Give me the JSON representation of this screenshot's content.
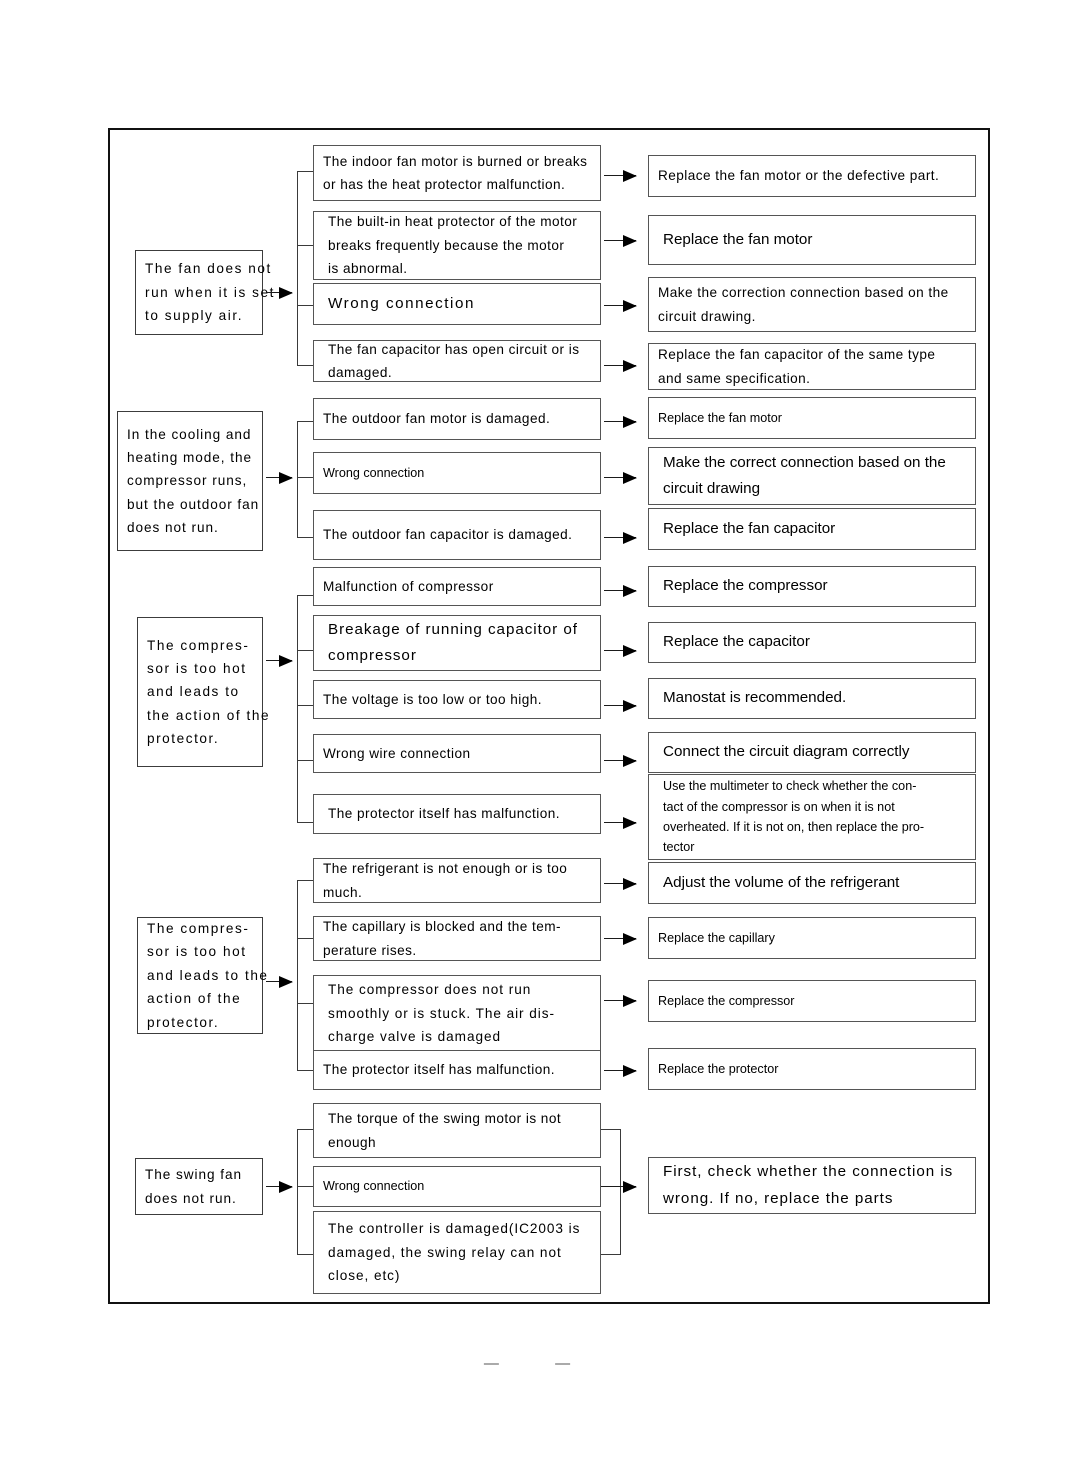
{
  "document": {
    "type": "troubleshooting-flowchart",
    "title": "Air conditioner fault diagnosis chart",
    "footer_marks": "— —"
  },
  "flow": {
    "sections": [
      {
        "id": "fan-supply-air",
        "symptom": {
          "lines": [
            "The fan does not",
            "run when it is set",
            "to supply air."
          ]
        },
        "branches": [
          {
            "cause": {
              "lines": [
                "The indoor fan motor is burned or breaks",
                "or has the heat protector malfunction."
              ]
            },
            "action": {
              "lines": [
                "Replace the fan motor or the defective part."
              ]
            }
          },
          {
            "cause": {
              "lines": [
                "The built-in heat protector of the motor",
                "breaks frequently because the motor",
                "is abnormal."
              ]
            },
            "action": {
              "lines": [
                "Replace the fan motor"
              ]
            }
          },
          {
            "cause": {
              "lines": [
                "Wrong connection"
              ]
            },
            "action": {
              "lines": [
                "Make the correction connection based on the",
                "circuit drawing."
              ]
            }
          },
          {
            "cause": {
              "lines": [
                "The fan capacitor has open circuit or is",
                "damaged."
              ]
            },
            "action": {
              "lines": [
                "Replace the fan capacitor of the same type",
                "and same specification."
              ]
            }
          }
        ]
      },
      {
        "id": "outdoor-fan",
        "symptom": {
          "lines": [
            "In the cooling and",
            "heating mode, the",
            "compressor runs,",
            "but the outdoor fan",
            "does not run."
          ]
        },
        "branches": [
          {
            "cause": {
              "lines": [
                "The outdoor fan motor is damaged."
              ]
            },
            "action": {
              "lines": [
                "Replace the fan motor"
              ]
            }
          },
          {
            "cause": {
              "lines": [
                "Wrong connection"
              ]
            },
            "action": {
              "lines": [
                "Make the correct connection based on the",
                "circuit drawing"
              ]
            }
          },
          {
            "cause": {
              "lines": [
                "The outdoor fan capacitor is damaged."
              ]
            },
            "action": {
              "lines": [
                "Replace the fan capacitor"
              ]
            }
          }
        ]
      },
      {
        "id": "compressor-hot-1",
        "symptom": {
          "lines": [
            "The compres-",
            "sor is too hot",
            "and leads to",
            "the action of the",
            "protector."
          ]
        },
        "branches": [
          {
            "cause": {
              "lines": [
                "Malfunction of compressor"
              ]
            },
            "action": {
              "lines": [
                "Replace the compressor"
              ]
            }
          },
          {
            "cause": {
              "lines": [
                "Breakage of running capacitor of",
                "compressor"
              ]
            },
            "action": {
              "lines": [
                "Replace the capacitor"
              ]
            }
          },
          {
            "cause": {
              "lines": [
                "The voltage is too low or too high."
              ]
            },
            "action": {
              "lines": [
                "Manostat is recommended."
              ]
            }
          },
          {
            "cause": {
              "lines": [
                "Wrong wire connection"
              ]
            },
            "action": {
              "lines": [
                "Connect the circuit diagram correctly"
              ]
            }
          },
          {
            "cause": {
              "lines": [
                "The protector itself has malfunction."
              ]
            },
            "action": {
              "lines": [
                "Use the multimeter to check whether the con-",
                "tact of the compressor is on when it is not",
                "overheated. If it is not on, then replace the pro-",
                "tector"
              ]
            }
          }
        ]
      },
      {
        "id": "compressor-hot-2",
        "symptom": {
          "lines": [
            "The compres-",
            "sor is too hot",
            "and leads to the",
            "action of the",
            "protector."
          ]
        },
        "branches": [
          {
            "cause": {
              "lines": [
                "The refrigerant is not enough or is too",
                "much."
              ]
            },
            "action": {
              "lines": [
                "Adjust the volume of the refrigerant"
              ]
            }
          },
          {
            "cause": {
              "lines": [
                "The capillary is blocked and the tem-",
                "perature rises."
              ]
            },
            "action": {
              "lines": [
                "Replace the capillary"
              ]
            }
          },
          {
            "cause": {
              "lines": [
                "The compressor does not run",
                "smoothly or is stuck. The air dis-",
                "charge valve is damaged"
              ]
            },
            "action": {
              "lines": [
                "Replace the compressor"
              ]
            }
          },
          {
            "cause": {
              "lines": [
                "The protector itself has malfunction."
              ]
            },
            "action": {
              "lines": [
                "Replace the protector"
              ]
            }
          }
        ]
      },
      {
        "id": "swing-fan",
        "symptom": {
          "lines": [
            "The swing fan",
            "does not run."
          ]
        },
        "shared_action": {
          "lines": [
            "First, check whether the connection is",
            "wrong. If no, replace the parts"
          ]
        },
        "branches": [
          {
            "cause": {
              "lines": [
                "The torque of the swing motor is not",
                "enough"
              ]
            }
          },
          {
            "cause": {
              "lines": [
                "Wrong connection"
              ]
            }
          },
          {
            "cause": {
              "lines": [
                "The controller is damaged(IC2003 is",
                "damaged, the swing relay can not",
                "close, etc)"
              ]
            }
          }
        ]
      }
    ]
  }
}
